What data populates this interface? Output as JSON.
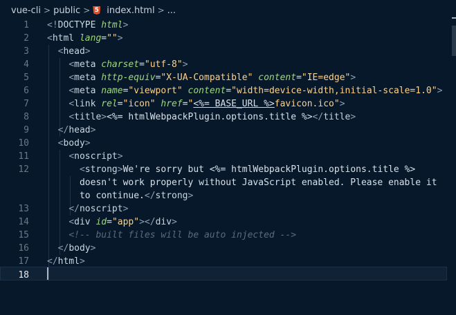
{
  "breadcrumb": {
    "items": [
      "vue-cli",
      "public",
      "index.html",
      "..."
    ],
    "separator": ">",
    "file_icon": "html5-icon"
  },
  "editor": {
    "active_line": 18,
    "gutter": [
      "1",
      "2",
      "3",
      "4",
      "5",
      "6",
      "7",
      "8",
      "9",
      "10",
      "11",
      "12",
      "",
      "",
      "13",
      "14",
      "15",
      "16",
      "17",
      "18"
    ],
    "lines": [
      [
        {
          "c": "c-br",
          "t": "<!"
        },
        {
          "c": "c-tag",
          "t": "DOCTYPE"
        },
        {
          "c": "c-txt",
          "t": " "
        },
        {
          "c": "c-attr",
          "t": "html"
        },
        {
          "c": "c-br",
          "t": ">"
        }
      ],
      [
        {
          "c": "c-br",
          "t": "<"
        },
        {
          "c": "c-tag",
          "t": "html"
        },
        {
          "c": "c-txt",
          "t": " "
        },
        {
          "c": "c-attr",
          "t": "lang"
        },
        {
          "c": "c-txt",
          "t": "="
        },
        {
          "c": "c-str",
          "t": "\"\""
        },
        {
          "c": "c-br",
          "t": ">"
        }
      ],
      [
        {
          "c": "c-txt",
          "t": "  "
        },
        {
          "c": "c-br",
          "t": "<"
        },
        {
          "c": "c-tag",
          "t": "head"
        },
        {
          "c": "c-br",
          "t": ">"
        }
      ],
      [
        {
          "c": "c-txt",
          "t": "    "
        },
        {
          "c": "c-br",
          "t": "<"
        },
        {
          "c": "c-tag",
          "t": "meta"
        },
        {
          "c": "c-txt",
          "t": " "
        },
        {
          "c": "c-attr",
          "t": "charset"
        },
        {
          "c": "c-txt",
          "t": "="
        },
        {
          "c": "c-str",
          "t": "\"utf-8\""
        },
        {
          "c": "c-br",
          "t": ">"
        }
      ],
      [
        {
          "c": "c-txt",
          "t": "    "
        },
        {
          "c": "c-br",
          "t": "<"
        },
        {
          "c": "c-tag",
          "t": "meta"
        },
        {
          "c": "c-txt",
          "t": " "
        },
        {
          "c": "c-attr",
          "t": "http-equiv"
        },
        {
          "c": "c-txt",
          "t": "="
        },
        {
          "c": "c-str",
          "t": "\"X-UA-Compatible\""
        },
        {
          "c": "c-txt",
          "t": " "
        },
        {
          "c": "c-attr",
          "t": "content"
        },
        {
          "c": "c-txt",
          "t": "="
        },
        {
          "c": "c-str",
          "t": "\"IE=edge\""
        },
        {
          "c": "c-br",
          "t": ">"
        }
      ],
      [
        {
          "c": "c-txt",
          "t": "    "
        },
        {
          "c": "c-br",
          "t": "<"
        },
        {
          "c": "c-tag",
          "t": "meta"
        },
        {
          "c": "c-txt",
          "t": " "
        },
        {
          "c": "c-attr",
          "t": "name"
        },
        {
          "c": "c-txt",
          "t": "="
        },
        {
          "c": "c-str",
          "t": "\"viewport\""
        },
        {
          "c": "c-txt",
          "t": " "
        },
        {
          "c": "c-attr",
          "t": "content"
        },
        {
          "c": "c-txt",
          "t": "="
        },
        {
          "c": "c-str",
          "t": "\"width=device-width,initial-scale=1.0\""
        },
        {
          "c": "c-br",
          "t": ">"
        }
      ],
      [
        {
          "c": "c-txt",
          "t": "    "
        },
        {
          "c": "c-br",
          "t": "<"
        },
        {
          "c": "c-tag",
          "t": "link"
        },
        {
          "c": "c-txt",
          "t": " "
        },
        {
          "c": "c-attr",
          "t": "rel"
        },
        {
          "c": "c-txt",
          "t": "="
        },
        {
          "c": "c-str",
          "t": "\"icon\""
        },
        {
          "c": "c-txt",
          "t": " "
        },
        {
          "c": "c-attr",
          "t": "href"
        },
        {
          "c": "c-txt",
          "t": "="
        },
        {
          "c": "c-str",
          "t": "\""
        },
        {
          "c": "c-txt c-under",
          "t": "<%= BASE_URL %>"
        },
        {
          "c": "c-str",
          "t": "favicon.ico\""
        },
        {
          "c": "c-br",
          "t": ">"
        }
      ],
      [
        {
          "c": "c-txt",
          "t": "    "
        },
        {
          "c": "c-br",
          "t": "<"
        },
        {
          "c": "c-tag",
          "t": "title"
        },
        {
          "c": "c-br",
          "t": ">"
        },
        {
          "c": "c-txt",
          "t": "<%= htmlWebpackPlugin.options.title %>"
        },
        {
          "c": "c-br",
          "t": "</"
        },
        {
          "c": "c-tag",
          "t": "title"
        },
        {
          "c": "c-br",
          "t": ">"
        }
      ],
      [
        {
          "c": "c-txt",
          "t": "  "
        },
        {
          "c": "c-br",
          "t": "</"
        },
        {
          "c": "c-tag",
          "t": "head"
        },
        {
          "c": "c-br",
          "t": ">"
        }
      ],
      [
        {
          "c": "c-txt",
          "t": "  "
        },
        {
          "c": "c-br",
          "t": "<"
        },
        {
          "c": "c-tag",
          "t": "body"
        },
        {
          "c": "c-br",
          "t": ">"
        }
      ],
      [
        {
          "c": "c-txt",
          "t": "    "
        },
        {
          "c": "c-br",
          "t": "<"
        },
        {
          "c": "c-tag",
          "t": "noscript"
        },
        {
          "c": "c-br",
          "t": ">"
        }
      ],
      [
        {
          "c": "c-txt",
          "t": "      "
        },
        {
          "c": "c-br",
          "t": "<"
        },
        {
          "c": "c-tag",
          "t": "strong"
        },
        {
          "c": "c-br",
          "t": ">"
        },
        {
          "c": "c-txt",
          "t": "We're sorry but <%= htmlWebpackPlugin.options.title %>"
        }
      ],
      [
        {
          "c": "c-txt",
          "t": "      doesn't work properly without JavaScript enabled. Please enable it"
        }
      ],
      [
        {
          "c": "c-txt",
          "t": "      to continue."
        },
        {
          "c": "c-br",
          "t": "</"
        },
        {
          "c": "c-tag",
          "t": "strong"
        },
        {
          "c": "c-br",
          "t": ">"
        }
      ],
      [
        {
          "c": "c-txt",
          "t": "    "
        },
        {
          "c": "c-br",
          "t": "</"
        },
        {
          "c": "c-tag",
          "t": "noscript"
        },
        {
          "c": "c-br",
          "t": ">"
        }
      ],
      [
        {
          "c": "c-txt",
          "t": "    "
        },
        {
          "c": "c-br",
          "t": "<"
        },
        {
          "c": "c-tag",
          "t": "div"
        },
        {
          "c": "c-txt",
          "t": " "
        },
        {
          "c": "c-attr",
          "t": "id"
        },
        {
          "c": "c-txt",
          "t": "="
        },
        {
          "c": "c-str",
          "t": "\"app\""
        },
        {
          "c": "c-br",
          "t": "></"
        },
        {
          "c": "c-tag",
          "t": "div"
        },
        {
          "c": "c-br",
          "t": ">"
        }
      ],
      [
        {
          "c": "c-txt",
          "t": "    "
        },
        {
          "c": "c-com",
          "t": "<!-- built files will be auto injected -->"
        }
      ],
      [
        {
          "c": "c-txt",
          "t": "  "
        },
        {
          "c": "c-br",
          "t": "</"
        },
        {
          "c": "c-tag",
          "t": "body"
        },
        {
          "c": "c-br",
          "t": ">"
        }
      ],
      [
        {
          "c": "c-br",
          "t": "</"
        },
        {
          "c": "c-tag",
          "t": "html"
        },
        {
          "c": "c-br",
          "t": ">"
        }
      ],
      []
    ]
  }
}
